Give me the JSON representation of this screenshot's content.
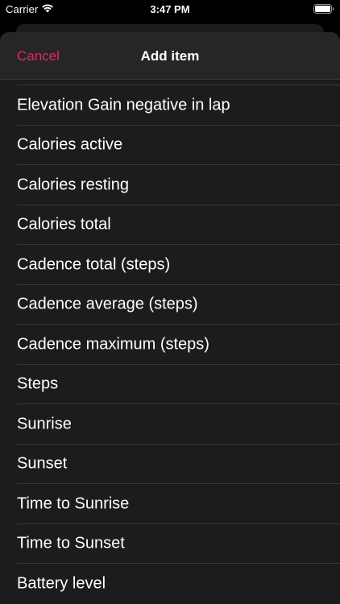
{
  "status_bar": {
    "carrier": "Carrier",
    "time": "3:47 PM",
    "wifi_icon": "wifi-icon",
    "battery_icon": "battery-full-icon"
  },
  "nav": {
    "cancel_label": "Cancel",
    "title": "Add item"
  },
  "items": [
    {
      "label": "Elevation Gain negative in lap"
    },
    {
      "label": "Calories active"
    },
    {
      "label": "Calories resting"
    },
    {
      "label": "Calories total"
    },
    {
      "label": "Cadence total (steps)"
    },
    {
      "label": "Cadence average (steps)"
    },
    {
      "label": "Cadence maximum (steps)"
    },
    {
      "label": "Steps"
    },
    {
      "label": "Sunrise"
    },
    {
      "label": "Sunset"
    },
    {
      "label": "Time to Sunrise"
    },
    {
      "label": "Time to Sunset"
    },
    {
      "label": "Battery level"
    }
  ],
  "colors": {
    "accent": "#e8275a",
    "background": "#000000",
    "sheet": "#1c1c1e",
    "separator": "#38383a",
    "text": "#ffffff"
  }
}
